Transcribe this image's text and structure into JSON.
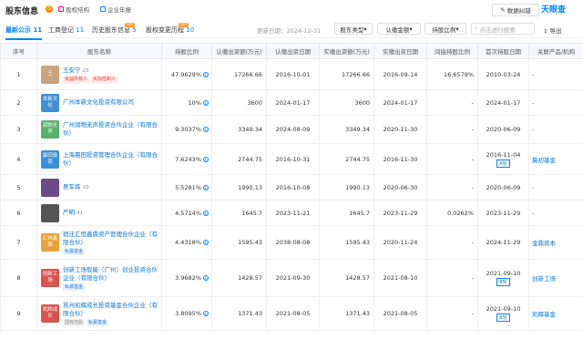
{
  "header": {
    "title": "股东信息",
    "title_count": "0",
    "chips": [
      "股权结构",
      "企业年报"
    ],
    "error_btn": "数据纠错",
    "logo": "天眼查"
  },
  "tabs": [
    {
      "label": "最新公示",
      "count": "11"
    },
    {
      "label": "工商登记",
      "count": "11"
    },
    {
      "label": "历史股东信息",
      "count": "5",
      "badge": "VIP"
    },
    {
      "label": "股权变更历程",
      "count": "10",
      "badge": "VIP"
    }
  ],
  "toolbar": {
    "updated": "更新日期：2024-12-31",
    "dd1": "股东类型",
    "dd2": "认缴金额",
    "dd3": "持股比例",
    "search_placeholder": "点击进行搜索",
    "export": "导出"
  },
  "columns": [
    "序号",
    "股东名称",
    "持股比例",
    "认缴出资额(万元)",
    "认缴出资日期",
    "实缴出资额(万元)",
    "实缴出资日期",
    "间接持股比例",
    "首次持股日期",
    "关联产品/机构"
  ],
  "rows": [
    {
      "no": "1",
      "avatar": "王",
      "avatar_color": "#c9a27e",
      "name": "王安宁",
      "count": "23",
      "tags": [
        [
          "受益所有人",
          "red"
        ],
        [
          "实际控制人",
          "red"
        ]
      ],
      "pct": "47.9629%",
      "sub": "17266.66",
      "sub_date": "2016-10-01",
      "paid": "17266.66",
      "paid_date": "2016-09-14",
      "indirect": "16.6579%",
      "first": "2010-03-24",
      "round": "",
      "rel": "-"
    },
    {
      "no": "2",
      "avatar": "本新文化",
      "avatar_color": "#3d8fd6",
      "name": "广州本新文化投资有限公司",
      "count": "",
      "tags": [],
      "pct": "10%",
      "sub": "3600",
      "sub_date": "2024-01-17",
      "paid": "3600",
      "paid_date": "2024-01-17",
      "indirect": "-",
      "first": "2024-01-17",
      "round": "",
      "rel": "-"
    },
    {
      "no": "3",
      "avatar": "润物无声",
      "avatar_color": "#58b06a",
      "name": "广州润物无声投资合伙企业（有限合伙）",
      "count": "",
      "tags": [],
      "pct": "9.3037%",
      "sub": "3349.34",
      "sub_date": "2024-08-09",
      "paid": "3349.34",
      "paid_date": "2020-11-30",
      "indirect": "-",
      "first": "2020-06-09",
      "round": "",
      "rel": "-"
    },
    {
      "no": "4",
      "avatar": "晨田投资",
      "avatar_color": "#3d8fd6",
      "name": "上海晨田投资管理合伙企业（有限合伙）",
      "count": "",
      "tags": [],
      "pct": "7.6243%",
      "sub": "2744.75",
      "sub_date": "2016-10-31",
      "paid": "2744.75",
      "paid_date": "2016-11-30",
      "indirect": "-",
      "first": "2016-11-04",
      "round": "A轮",
      "rel": "晨初基金"
    },
    {
      "no": "5",
      "avatar": "",
      "avatar_color": "#6b4a8a",
      "name": "吴军炼",
      "count": "10",
      "tags": [],
      "pct": "5.5281%",
      "sub": "1990.13",
      "sub_date": "2016-10-08",
      "paid": "1990.13",
      "paid_date": "2020-06-30",
      "indirect": "-",
      "first": "2020-06-09",
      "round": "",
      "rel": "-"
    },
    {
      "no": "6",
      "avatar": "",
      "avatar_color": "#555555",
      "name": "严明",
      "count": "41",
      "tags": [],
      "pct": "4.5714%",
      "sub": "1645.7",
      "sub_date": "2023-11-21",
      "paid": "1645.7",
      "paid_date": "2023-11-29",
      "indirect": "0.0262%",
      "first": "2023-11-29",
      "round": "",
      "rel": "-"
    },
    {
      "no": "7",
      "avatar": "汇恒鑫鼎",
      "avatar_color": "#e8a13a",
      "name": "宿迁汇恒鑫鼎资产管理合伙企业（有限合伙）",
      "count": "",
      "tags": [
        [
          "私募基金",
          "blue"
        ]
      ],
      "pct": "4.4318%",
      "sub": "1595.43",
      "sub_date": "2038-08-08",
      "paid": "1595.43",
      "paid_date": "2020-11-24",
      "indirect": "-",
      "first": "2024-11-29",
      "round": "",
      "rel": "金鼎资本"
    },
    {
      "no": "8",
      "avatar": "创新工场",
      "avatar_color": "#d9534f",
      "name": "创新工场智能（广州）创业投资合伙企业（有限合伙）",
      "count": "",
      "tags": [
        [
          "私募基金",
          "blue"
        ]
      ],
      "pct": "3.9682%",
      "sub": "1428.57",
      "sub_date": "2021-09-30",
      "paid": "1428.57",
      "paid_date": "2021-08-10",
      "indirect": "-",
      "first": "2021-09-10",
      "round": "B轮",
      "rel": "创新工场"
    },
    {
      "no": "9",
      "avatar": "凯辉成长",
      "avatar_color": "#d9534f",
      "name": "苏州凯辉成长投资基金合伙企业（有限合伙）",
      "count": "",
      "tags": [
        [
          "国有控股",
          "gray"
        ],
        [
          "私募基金",
          "blue"
        ]
      ],
      "pct": "3.8095%",
      "sub": "1371.43",
      "sub_date": "2021-08-05",
      "paid": "1371.43",
      "paid_date": "2021-08-05",
      "indirect": "-",
      "first": "2021-09-10",
      "round": "B轮",
      "rel": "凯辉基金"
    }
  ]
}
